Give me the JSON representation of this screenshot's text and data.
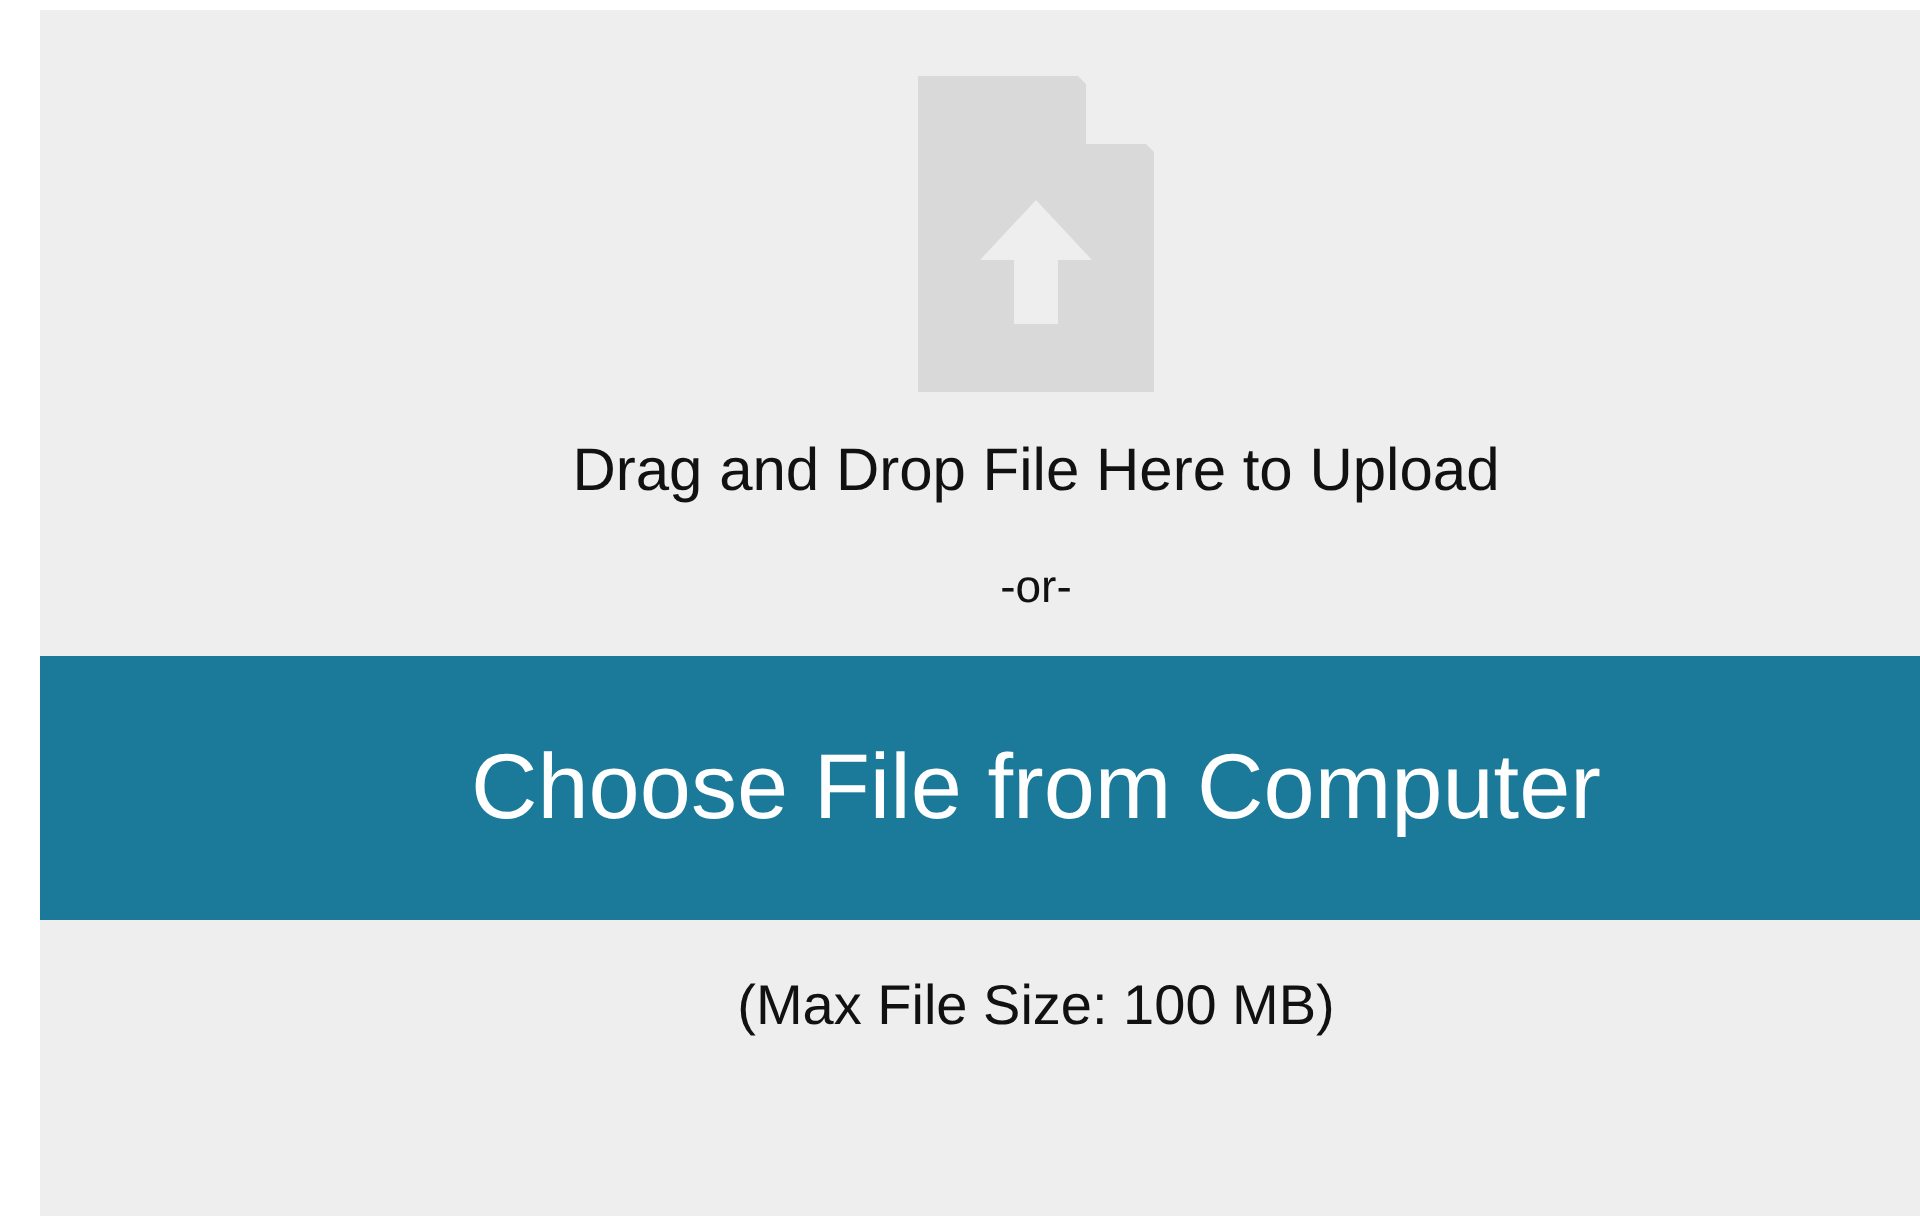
{
  "upload": {
    "prompt": "Drag and Drop File Here to Upload",
    "separator": "-or-",
    "button": "Choose File from Computer",
    "limit": "(Max File Size: 100 MB)"
  }
}
